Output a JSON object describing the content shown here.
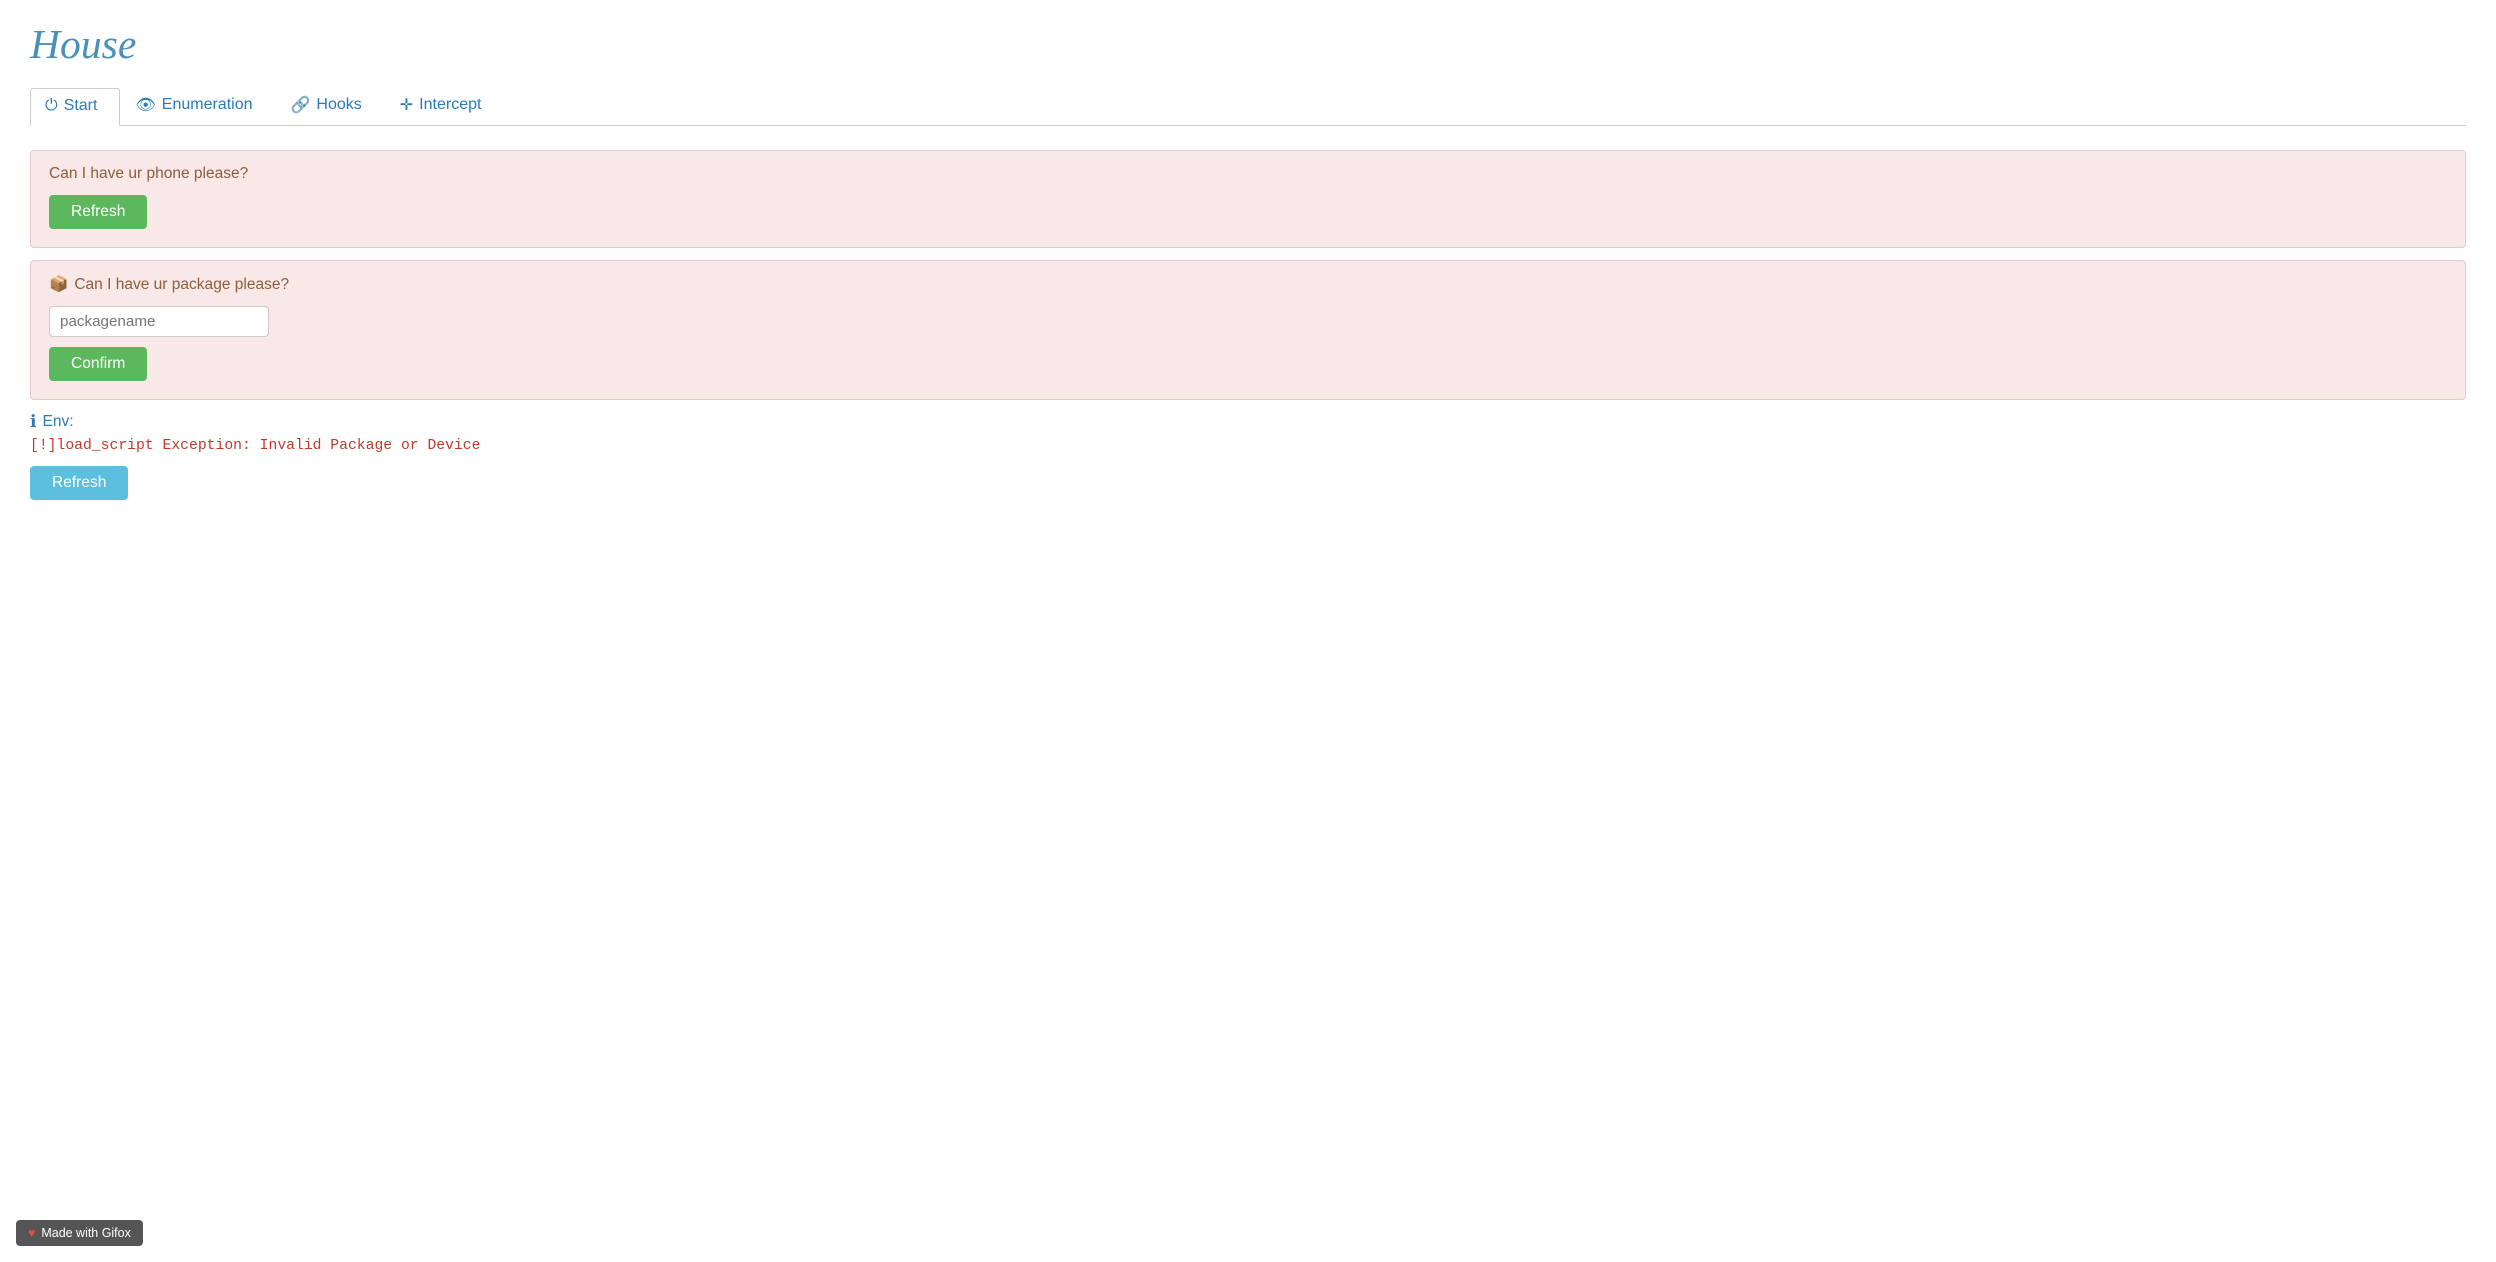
{
  "app": {
    "title": "House"
  },
  "tabs": [
    {
      "id": "start",
      "label": "Start",
      "icon": "⏻",
      "active": true
    },
    {
      "id": "enumeration",
      "label": "Enumeration",
      "icon": "👁",
      "active": false
    },
    {
      "id": "hooks",
      "label": "Hooks",
      "icon": "🔗",
      "active": false
    },
    {
      "id": "intercept",
      "label": "Intercept",
      "icon": "✛",
      "active": false
    }
  ],
  "section_phone": {
    "label": "Can I have ur phone please?",
    "button_label": "Refresh"
  },
  "section_package": {
    "icon": "📦",
    "label": "Can I have ur package please?",
    "input_placeholder": "packagename",
    "button_label": "Confirm"
  },
  "env_section": {
    "label": "Env:",
    "error_text": "[!]load_script Exception: Invalid Package or Device",
    "refresh_label": "Refresh"
  },
  "footer": {
    "text": "Made with Gifox"
  }
}
